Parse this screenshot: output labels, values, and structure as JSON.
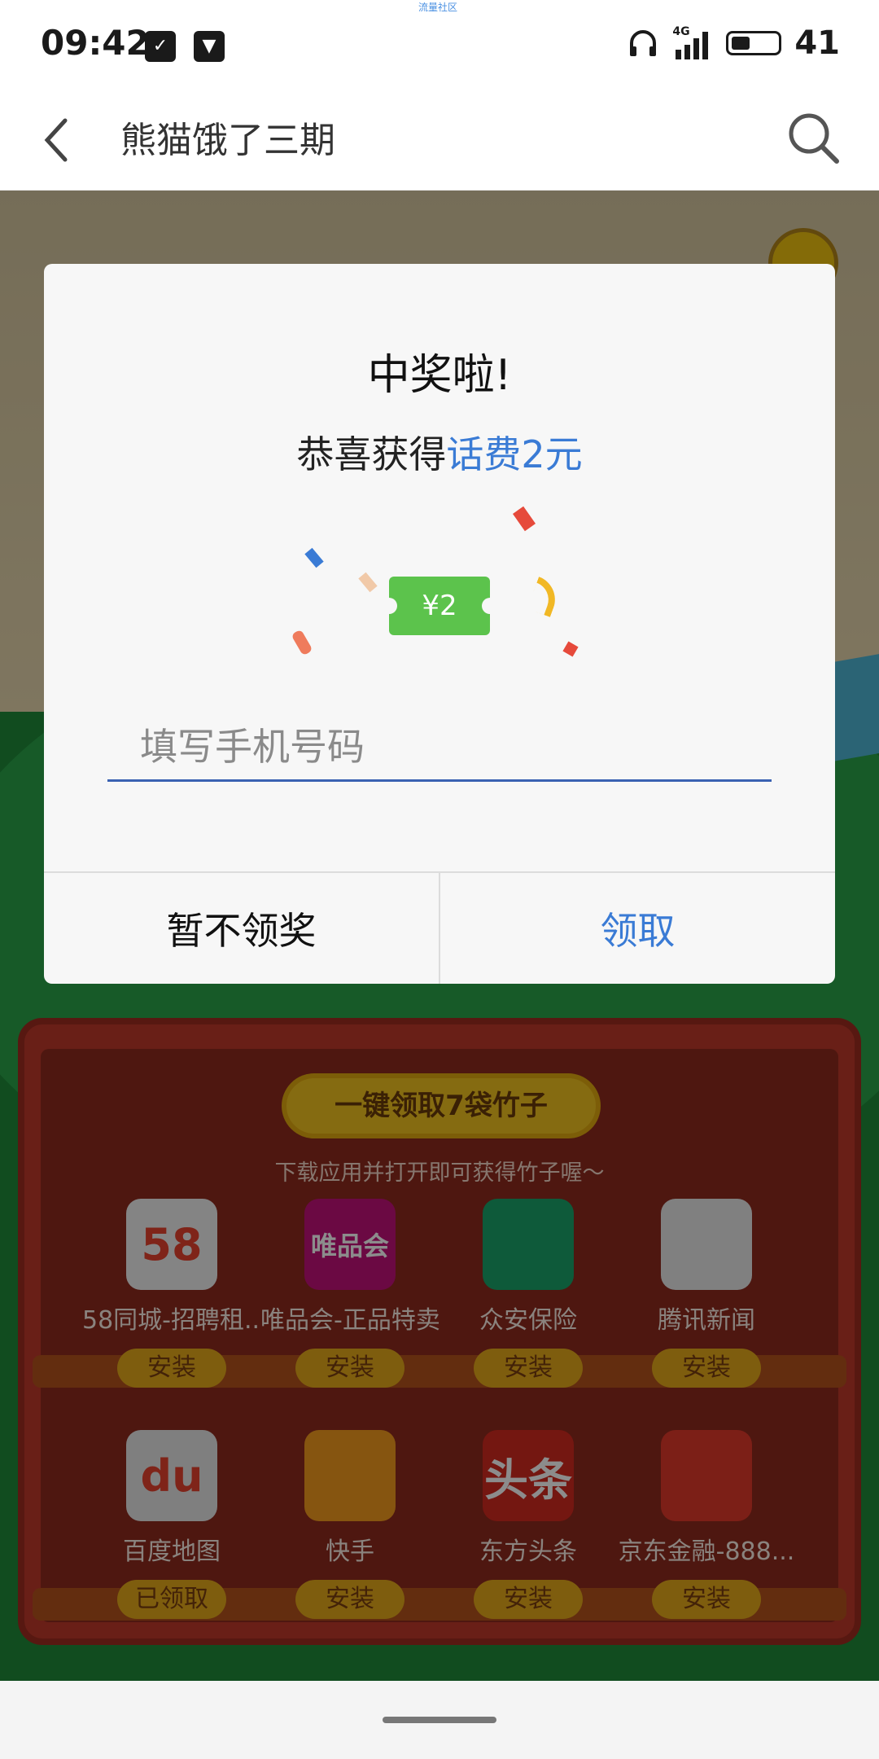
{
  "status": {
    "time": "09:42",
    "tiny_label": "流量社区",
    "network": "4G",
    "battery_level": "41",
    "battery_fraction": 0.41
  },
  "topbar": {
    "title": "熊猫饿了三期"
  },
  "dialog": {
    "title": "中奖啦!",
    "subtitle_prefix": "恭喜获得",
    "subtitle_highlight": "话费2元",
    "voucher": "¥2",
    "phone_placeholder": "填写手机号码",
    "cancel_label": "暂不领奖",
    "confirm_label": "领取"
  },
  "shelf": {
    "claim_all": "一键领取7袋竹子",
    "hint": "下载应用并打开即可获得竹子喔～",
    "apps": [
      {
        "name": "58同城-招聘租...",
        "button": "安装",
        "icon": "58-icon",
        "icon_text": "58",
        "color": "#f0f0f0"
      },
      {
        "name": "唯品会-正品特卖",
        "button": "安装",
        "icon": "vipshop-icon",
        "icon_text": "唯品会",
        "color": "#c3117a"
      },
      {
        "name": "众安保险",
        "button": "安装",
        "icon": "zhongan-icon",
        "icon_text": "",
        "color": "#1aa56b"
      },
      {
        "name": "腾讯新闻",
        "button": "安装",
        "icon": "tencent-news-icon",
        "icon_text": "",
        "color": "#e9e9e9"
      },
      {
        "name": "百度地图",
        "button": "已领取",
        "icon": "baidu-map-icon",
        "icon_text": "du",
        "color": "#e8e8e8"
      },
      {
        "name": "快手",
        "button": "安装",
        "icon": "kuaishou-icon",
        "icon_text": "",
        "color": "#f59b1e"
      },
      {
        "name": "东方头条",
        "button": "安装",
        "icon": "dongfang-toutiao-icon",
        "icon_text": "头条",
        "color": "#d42a1f"
      },
      {
        "name": "京东金融-888...",
        "button": "安装",
        "icon": "jd-finance-icon",
        "icon_text": "",
        "color": "#e23a2b"
      }
    ]
  }
}
